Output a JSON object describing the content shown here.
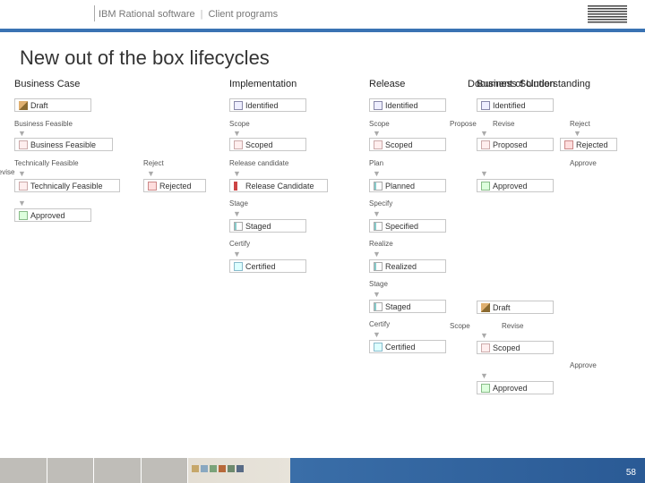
{
  "header": {
    "brand": "IBM Rational software",
    "section": "Client programs"
  },
  "title": "New out of the box lifecycles",
  "columns": {
    "business_case": "Business Case",
    "implementation": "Implementation",
    "release": "Release",
    "business_solution": "Business Solution",
    "doc_understanding": "Document of Understanding"
  },
  "labels": {
    "business_feasible": "Business Feasible",
    "technically_feasible": "Technically Feasible",
    "revise": "Revise",
    "reject": "Reject",
    "scope_l": "Scope",
    "release_candidate": "Release candidate",
    "stage": "Stage",
    "certify": "Certify",
    "plan": "Plan",
    "specify": "Specify",
    "realize": "Realize",
    "propose": "Propose",
    "approve": "Approve",
    "scope_d": "Scope"
  },
  "states": {
    "draft": "Draft",
    "identified": "Identified",
    "bus_feasible": "Business Feasible",
    "scoped": "Scoped",
    "tech_feasible": "Technically Feasible",
    "rejected": "Rejected",
    "release_cand": "Release Candidate",
    "approved": "Approved",
    "staged": "Staged",
    "certified": "Certified",
    "planned": "Planned",
    "specified": "Specified",
    "realized": "Realized",
    "proposed": "Proposed"
  },
  "page_number": "58"
}
